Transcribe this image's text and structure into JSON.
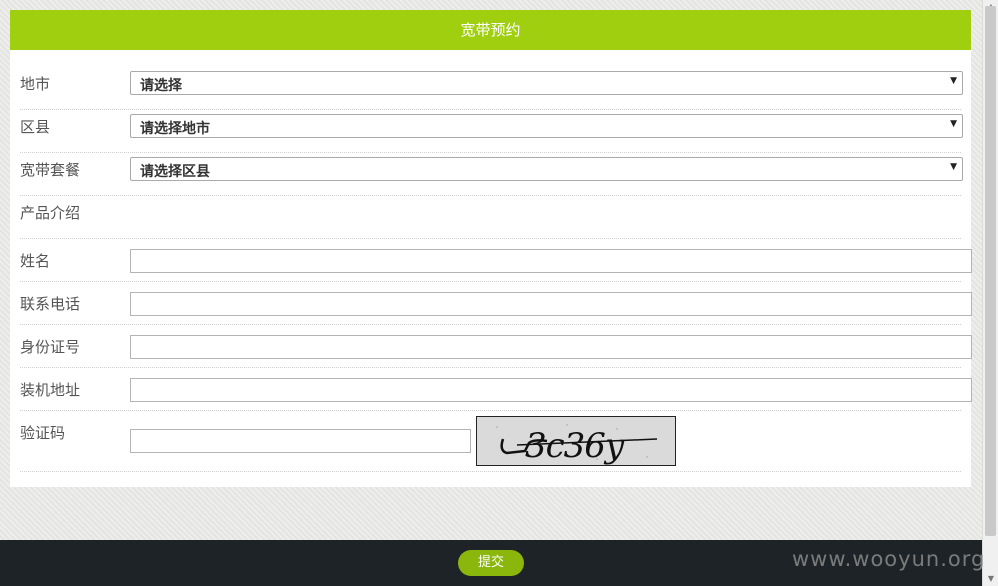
{
  "header": {
    "title": "宽带预约"
  },
  "form": {
    "city": {
      "label": "地市",
      "value": "请选择"
    },
    "district": {
      "label": "区县",
      "value": "请选择地市"
    },
    "package": {
      "label": "宽带套餐",
      "value": "请选择区县"
    },
    "intro": {
      "label": "产品介绍"
    },
    "name": {
      "label": "姓名",
      "value": ""
    },
    "phone": {
      "label": "联系电话",
      "value": ""
    },
    "id_number": {
      "label": "身份证号",
      "value": ""
    },
    "address": {
      "label": "装机地址",
      "value": ""
    },
    "captcha": {
      "label": "验证码",
      "value": "",
      "image_text": "3c36y"
    }
  },
  "footer": {
    "submit_label": "提交",
    "watermark": "www.wooyun.org"
  },
  "colors": {
    "accent": "#a0cf10",
    "button": "#8bb70d",
    "footer_bg": "#1d2326"
  },
  "icons": {
    "dropdown": "caret-down-icon"
  }
}
